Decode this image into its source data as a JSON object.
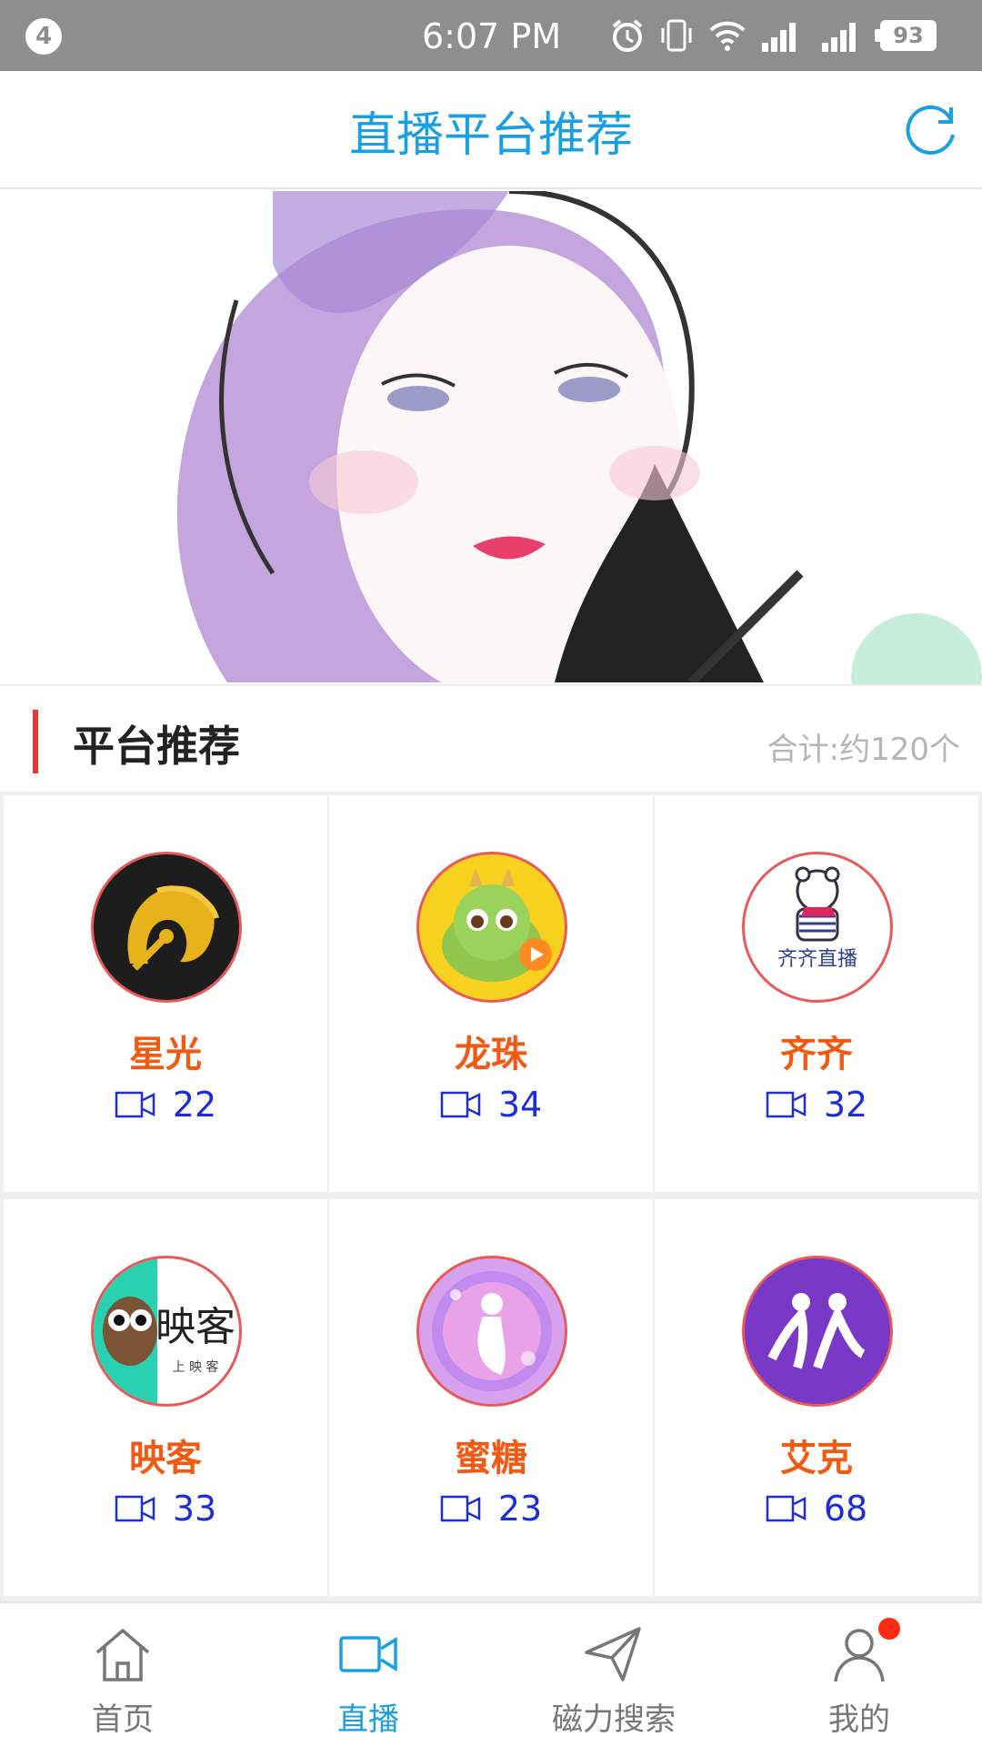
{
  "status_bar": {
    "notification_count": "4",
    "time": "6:07 PM",
    "battery": "93"
  },
  "header": {
    "title": "直播平台推荐"
  },
  "section": {
    "title": "平台推荐",
    "count_text": "合计:约120个"
  },
  "platforms": [
    {
      "name": "星光",
      "count": "22"
    },
    {
      "name": "龙珠",
      "count": "34"
    },
    {
      "name": "齐齐",
      "count": "32"
    },
    {
      "name": "映客",
      "count": "33"
    },
    {
      "name": "蜜糖",
      "count": "23"
    },
    {
      "name": "艾克",
      "count": "68"
    }
  ],
  "logo_text": {
    "qiqi": "齐齐直播",
    "yingke": "映客",
    "yingke_sub": "上 映 客"
  },
  "bottom_nav": [
    {
      "label": "首页",
      "icon": "home-icon"
    },
    {
      "label": "直播",
      "icon": "video-icon"
    },
    {
      "label": "磁力搜索",
      "icon": "send-icon"
    },
    {
      "label": "我的",
      "icon": "user-icon"
    }
  ],
  "colors": {
    "accent": "#1aa0e0",
    "name": "#f05a12",
    "count": "#1c2fd6",
    "section_bar": "#e53935"
  }
}
